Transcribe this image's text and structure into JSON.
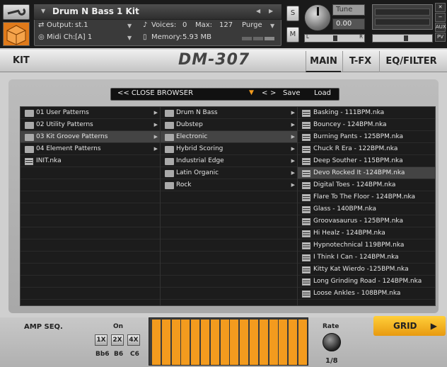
{
  "header": {
    "instrument_name": "Drum N Bass 1 Kit",
    "output_label": "Output:",
    "output_value": "st.1",
    "voices_label": "Voices:",
    "voices_value": "0",
    "max_label": "Max:",
    "max_value": "127",
    "purge_label": "Purge",
    "midi_label": "Midi Ch:",
    "midi_value": "[A]  1",
    "memory_label": "Memory:",
    "memory_value": "5.93 MB",
    "solo_label": "S",
    "mute_label": "M",
    "tune_label": "Tune",
    "tune_value": "0.00",
    "pan_left": "L",
    "pan_right": "R",
    "aux_label": "AUX",
    "pv_label": "PV"
  },
  "tabs": {
    "kit": "KIT",
    "product": "DM-307",
    "main": "MAIN",
    "tfx": "T-FX",
    "eqfilter": "EQ/FILTER"
  },
  "browser": {
    "close_label": "<< CLOSE BROWSER",
    "prev_label": "<",
    "next_label": ">",
    "save_label": "Save",
    "load_label": "Load",
    "col1": [
      {
        "label": "01 User Patterns",
        "type": "folder",
        "arrow": true
      },
      {
        "label": "02 Utility Patterns",
        "type": "folder",
        "arrow": true
      },
      {
        "label": "03 Kit Groove Patterns",
        "type": "folder",
        "arrow": true,
        "selected": true
      },
      {
        "label": "04 Element Patterns",
        "type": "folder",
        "arrow": true
      },
      {
        "label": "INIT.nka",
        "type": "file"
      }
    ],
    "col2": [
      {
        "label": "Drum N Bass",
        "type": "folder",
        "arrow": true
      },
      {
        "label": "Dubstep",
        "type": "folder",
        "arrow": true
      },
      {
        "label": "Electronic",
        "type": "folder",
        "arrow": true,
        "selected": true
      },
      {
        "label": "Hybrid Scoring",
        "type": "folder",
        "arrow": true
      },
      {
        "label": "Industrial Edge",
        "type": "folder",
        "arrow": true
      },
      {
        "label": "Latin Organic",
        "type": "folder",
        "arrow": true
      },
      {
        "label": "Rock",
        "type": "folder",
        "arrow": true
      }
    ],
    "col3": [
      {
        "label": "Basking - 111BPM.nka",
        "type": "file"
      },
      {
        "label": "Bouncey - 124BPM.nka",
        "type": "file"
      },
      {
        "label": "Burning Pants - 125BPM.nka",
        "type": "file"
      },
      {
        "label": "Chuck R Era - 122BPM.nka",
        "type": "file"
      },
      {
        "label": "Deep Souther - 115BPM.nka",
        "type": "file"
      },
      {
        "label": "Devo Rocked It -124BPM.nka",
        "type": "file",
        "selected": true
      },
      {
        "label": "Digital Toes - 124BPM.nka",
        "type": "file"
      },
      {
        "label": "Flare To The Floor - 124BPM.nka",
        "type": "file"
      },
      {
        "label": "Glass - 140BPM.nka",
        "type": "file"
      },
      {
        "label": "Groovasaurus - 125BPM.nka",
        "type": "file"
      },
      {
        "label": "Hi Healz - 124BPM.nka",
        "type": "file"
      },
      {
        "label": "Hypnotechnical 119BPM.nka",
        "type": "file"
      },
      {
        "label": "I Think I Can - 124BPM.nka",
        "type": "file"
      },
      {
        "label": "Kitty Kat Wierdo -125BPM.nka",
        "type": "file"
      },
      {
        "label": "Long Grinding Road - 124BPM.nka",
        "type": "file"
      },
      {
        "label": "Loose Ankles - 108BPM.nka",
        "type": "file"
      }
    ]
  },
  "ampseq": {
    "label": "AMP SEQ.",
    "on_label": "On",
    "oct_buttons": [
      "1X",
      "2X",
      "4X"
    ],
    "oct_notes": [
      "Bb6",
      "B6",
      "C6"
    ],
    "rate_label": "Rate",
    "rate_value": "1/8",
    "grid_label": "GRID",
    "step_count": 16
  }
}
